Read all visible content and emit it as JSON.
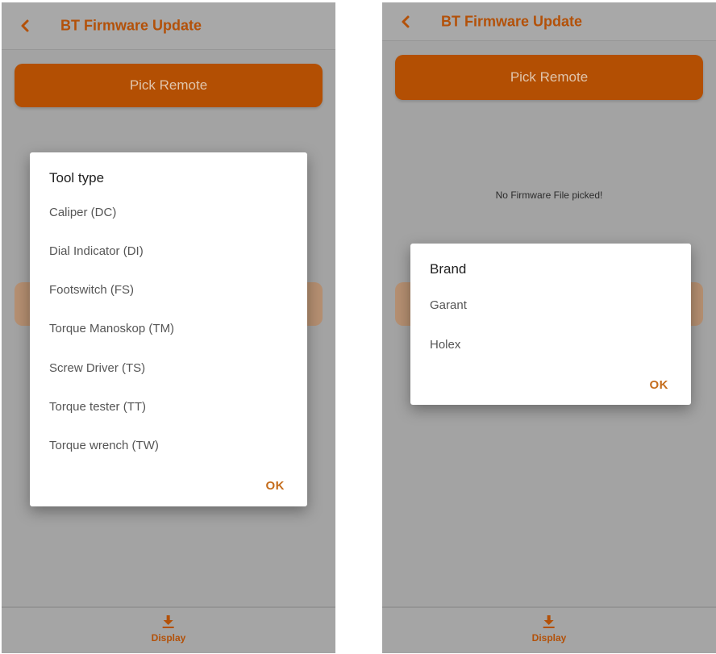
{
  "colors": {
    "accent": "#b35109",
    "button": "#b34f03",
    "button_text": "#e0c5ac",
    "overlay": "#a3a3a3",
    "dialog": "#ffffff"
  },
  "left_screen": {
    "title": "BT Firmware Update",
    "back_icon": "chevron-left-icon",
    "pick_button": "Pick Remote",
    "dialog": {
      "title": "Tool type",
      "options": [
        "Caliper (DC)",
        "Dial Indicator (DI)",
        "Footswitch (FS)",
        "Torque Manoskop (TM)",
        "Screw Driver (TS)",
        "Torque tester (TT)",
        "Torque wrench (TW)"
      ],
      "ok": "OK"
    },
    "bottom_nav": {
      "icon": "download-icon",
      "label": "Display"
    }
  },
  "right_screen": {
    "title": "BT Firmware Update",
    "back_icon": "chevron-left-icon",
    "pick_button": "Pick Remote",
    "status": "No Firmware File picked!",
    "dialog": {
      "title": "Brand",
      "options": [
        "Garant",
        "Holex"
      ],
      "ok": "OK"
    },
    "bottom_nav": {
      "icon": "download-icon",
      "label": "Display"
    }
  }
}
